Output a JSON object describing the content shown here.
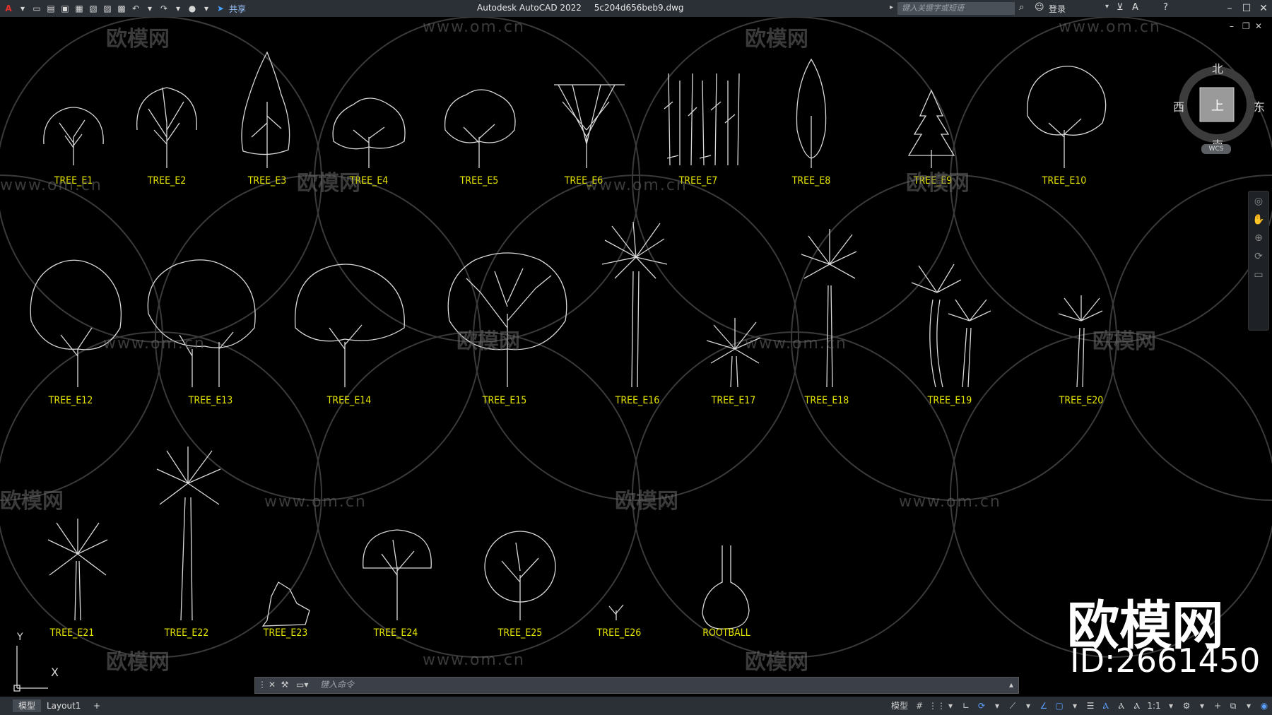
{
  "app": {
    "title": "Autodesk AutoCAD 2022",
    "filename": "5c204d656beb9.dwg",
    "share_label": "共享",
    "search_placeholder": "键入关键字或短语",
    "login_label": "登录"
  },
  "viewcube": {
    "north": "北",
    "south": "南",
    "west": "西",
    "east": "东",
    "top_face": "上",
    "wcs": "WCS"
  },
  "labels": [
    {
      "id": "e1",
      "text": "TREE_E1"
    },
    {
      "id": "e2",
      "text": "TREE_E2"
    },
    {
      "id": "e3",
      "text": "TREE_E3"
    },
    {
      "id": "e4",
      "text": "TREE_E4"
    },
    {
      "id": "e5",
      "text": "TREE_E5"
    },
    {
      "id": "e6",
      "text": "TREE_E6"
    },
    {
      "id": "e7",
      "text": "TREE_E7"
    },
    {
      "id": "e8",
      "text": "TREE_E8"
    },
    {
      "id": "e9",
      "text": "TREE_E9"
    },
    {
      "id": "e10",
      "text": "TREE_E10"
    },
    {
      "id": "e12",
      "text": "TREE_E12"
    },
    {
      "id": "e13",
      "text": "TREE_E13"
    },
    {
      "id": "e14",
      "text": "TREE_E14"
    },
    {
      "id": "e15",
      "text": "TREE_E15"
    },
    {
      "id": "e16",
      "text": "TREE_E16"
    },
    {
      "id": "e17",
      "text": "TREE_E17"
    },
    {
      "id": "e18",
      "text": "TREE_E18"
    },
    {
      "id": "e19",
      "text": "TREE_E19"
    },
    {
      "id": "e20",
      "text": "TREE_E20"
    },
    {
      "id": "e21",
      "text": "TREE_E21"
    },
    {
      "id": "e22",
      "text": "TREE_E22"
    },
    {
      "id": "e23",
      "text": "TREE_E23"
    },
    {
      "id": "e24",
      "text": "TREE_E24"
    },
    {
      "id": "e25",
      "text": "TREE_E25"
    },
    {
      "id": "e26",
      "text": "TREE_E26"
    },
    {
      "id": "rb",
      "text": "ROOTBALL"
    }
  ],
  "watermark": {
    "brand": "欧模网",
    "url": "www.om.cn",
    "id_text": "ID:2661450"
  },
  "command": {
    "placeholder": "键入命令"
  },
  "ucs": {
    "x": "X",
    "y": "Y"
  },
  "status": {
    "tab_model": "模型",
    "tab_layout": "Layout1",
    "add_tab": "+",
    "model_label": "模型",
    "scale": "1:1"
  },
  "colors": {
    "label": "#e6e600",
    "linework": "#d9d9d9",
    "background": "#000000",
    "chrome": "#2b3036"
  }
}
